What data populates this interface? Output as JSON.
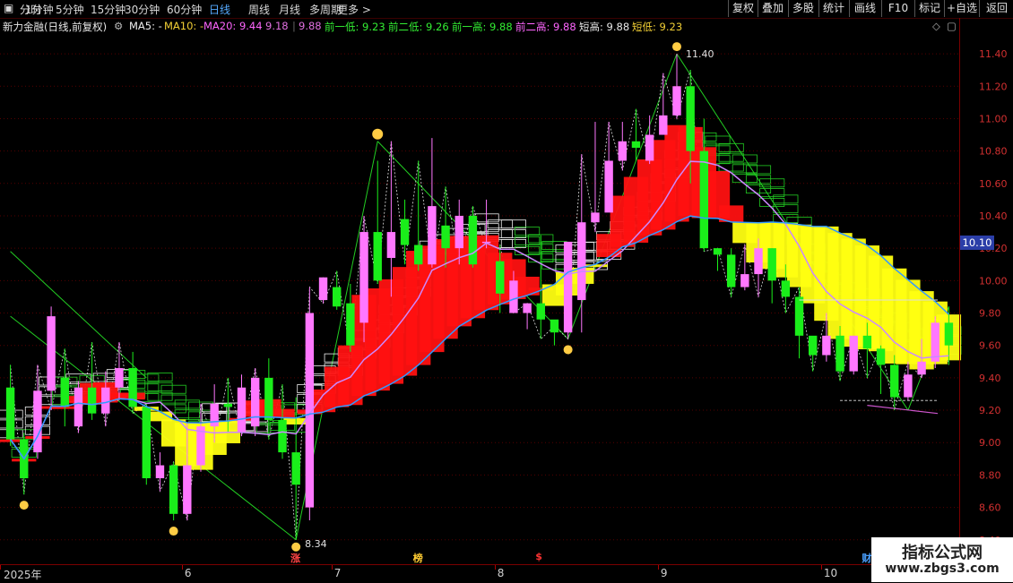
{
  "toolbar": {
    "left": [
      "分时",
      "1分钟",
      "5分钟",
      "15分钟",
      "30分钟",
      "60分钟",
      "日线",
      "周线",
      "月线",
      "多周期",
      "更多 >"
    ],
    "active": "日线",
    "right": [
      "复权",
      "叠加",
      "多股",
      "统计",
      "画线",
      "F10",
      "标记",
      "+自选",
      "返回"
    ]
  },
  "info": {
    "name": "新力金融(日线,前复权)",
    "ma5": "MA5: -",
    "ma10": "MA10: -",
    "ma20": "MA20: 9.44",
    "range1": "9.18",
    "range2": "9.88",
    "low1": "前一低: 9.23",
    "low2": "前二低: 9.26",
    "high1": "前一高: 9.88",
    "high2": "前二高: 9.88",
    "short_high": "短高: 9.88",
    "short_low": "短低: 9.23"
  },
  "colors": {
    "up": "#ff77ff",
    "down": "#1aee1a",
    "red": "#ff1111",
    "yellow": "#ffff11",
    "ma_purple": "#cc88ff",
    "ma_blue": "#3399ff",
    "grid": "#550000",
    "axis_text": "#d23030"
  },
  "chart_data": {
    "type": "candlestick",
    "y_ticks": [
      "8.40",
      "8.60",
      "8.80",
      "9.00",
      "9.20",
      "9.40",
      "9.60",
      "9.80",
      "10.00",
      "10.20",
      "10.40",
      "10.60",
      "10.80",
      "11.00",
      "11.20",
      "11.40"
    ],
    "ylim": [
      8.36,
      11.5
    ],
    "current_price": "10.10",
    "x_labels": [
      "2025年",
      "6",
      "7",
      "8",
      "9",
      "10"
    ],
    "x_label_index": [
      0,
      13,
      24,
      36,
      48,
      60
    ],
    "annotations": {
      "high_label": "11.40",
      "low_label": "8.34"
    },
    "events": [
      "涨",
      "榜",
      "$",
      "财"
    ],
    "event_index": [
      21,
      30,
      39,
      63
    ],
    "candles": [
      [
        9.34,
        9.02,
        9.48,
        8.98
      ],
      [
        9.02,
        8.78,
        9.06,
        8.68
      ],
      [
        8.94,
        9.32,
        9.48,
        8.9
      ],
      [
        9.32,
        9.78,
        9.84,
        9.2
      ],
      [
        9.4,
        9.22,
        9.58,
        9.1
      ],
      [
        9.1,
        9.34,
        9.38,
        9.06
      ],
      [
        9.34,
        9.18,
        9.62,
        9.14
      ],
      [
        9.18,
        9.34,
        9.44,
        9.1
      ],
      [
        9.34,
        9.46,
        9.62,
        9.26
      ],
      [
        9.46,
        9.22,
        9.56,
        9.18
      ],
      [
        9.22,
        8.78,
        9.24,
        8.74
      ],
      [
        8.78,
        8.86,
        8.94,
        8.7
      ],
      [
        8.86,
        8.56,
        8.88,
        8.52
      ],
      [
        8.56,
        8.86,
        9.12,
        8.52
      ],
      [
        8.86,
        9.1,
        9.24,
        8.82
      ],
      [
        9.1,
        9.24,
        9.36,
        9.0
      ],
      [
        9.24,
        9.22,
        9.4,
        9.06
      ],
      [
        9.06,
        9.34,
        9.42,
        9.04
      ],
      [
        9.1,
        9.4,
        9.46,
        9.04
      ],
      [
        9.4,
        9.14,
        9.52,
        9.02
      ],
      [
        9.14,
        8.94,
        9.36,
        8.9
      ],
      [
        8.94,
        8.74,
        9.28,
        8.4
      ],
      [
        8.6,
        9.8,
        9.96,
        8.52
      ],
      [
        9.88,
        10.02,
        10.02,
        9.86
      ],
      [
        9.96,
        9.84,
        10.06,
        9.82
      ],
      [
        9.86,
        9.6,
        9.98,
        9.56
      ],
      [
        9.74,
        10.3,
        10.4,
        9.62
      ],
      [
        10.3,
        10.0,
        10.74,
        9.98
      ],
      [
        10.14,
        10.3,
        10.86,
        9.9
      ],
      [
        10.38,
        10.22,
        10.5,
        10.1
      ],
      [
        10.22,
        10.1,
        10.74,
        10.06
      ],
      [
        10.1,
        10.46,
        10.88,
        10.08
      ],
      [
        10.34,
        10.2,
        10.58,
        10.08
      ],
      [
        10.2,
        10.4,
        10.5,
        10.1
      ],
      [
        10.4,
        10.1,
        10.46,
        10.08
      ],
      [
        10.24,
        10.24,
        10.5,
        10.2
      ],
      [
        10.12,
        9.92,
        10.22,
        9.8
      ],
      [
        9.8,
        10.0,
        10.06,
        9.8
      ],
      [
        9.8,
        9.86,
        9.86,
        9.7
      ],
      [
        9.86,
        9.76,
        10.28,
        9.64
      ],
      [
        9.76,
        9.68,
        9.72,
        9.6
      ],
      [
        9.68,
        10.24,
        10.24,
        9.64
      ],
      [
        9.88,
        10.36,
        10.78,
        9.68
      ],
      [
        10.36,
        10.42,
        10.98,
        10.3
      ],
      [
        10.42,
        10.74,
        10.98,
        10.66
      ],
      [
        10.74,
        10.86,
        10.98,
        10.68
      ],
      [
        10.86,
        10.82,
        11.06,
        10.74
      ],
      [
        10.74,
        10.9,
        11.02,
        10.72
      ],
      [
        10.9,
        11.02,
        11.28,
        10.9
      ],
      [
        11.02,
        11.2,
        11.4,
        11.0
      ],
      [
        11.2,
        10.8,
        11.3,
        10.6
      ],
      [
        10.8,
        10.2,
        11.0,
        10.18
      ],
      [
        10.2,
        10.16,
        10.2,
        10.06
      ],
      [
        10.16,
        9.96,
        10.2,
        9.9
      ],
      [
        9.96,
        10.04,
        10.22,
        9.94
      ],
      [
        10.04,
        10.2,
        10.26,
        9.9
      ],
      [
        10.2,
        10.0,
        10.2,
        9.86
      ],
      [
        10.0,
        9.9,
        10.1,
        9.8
      ],
      [
        9.9,
        9.66,
        9.96,
        9.52
      ],
      [
        9.66,
        9.54,
        9.62,
        9.44
      ],
      [
        9.54,
        9.66,
        9.8,
        9.5
      ],
      [
        9.66,
        9.44,
        9.72,
        9.38
      ],
      [
        9.44,
        9.66,
        9.66,
        9.42
      ],
      [
        9.66,
        9.58,
        9.74,
        9.4
      ],
      [
        9.58,
        9.48,
        9.6,
        9.3
      ],
      [
        9.48,
        9.28,
        9.54,
        9.2
      ],
      [
        9.28,
        9.42,
        9.5,
        9.26
      ],
      [
        9.42,
        9.5,
        9.64,
        9.4
      ],
      [
        9.5,
        9.74,
        9.78,
        9.46
      ],
      [
        9.74,
        9.6,
        9.84,
        9.48
      ]
    ]
  }
}
